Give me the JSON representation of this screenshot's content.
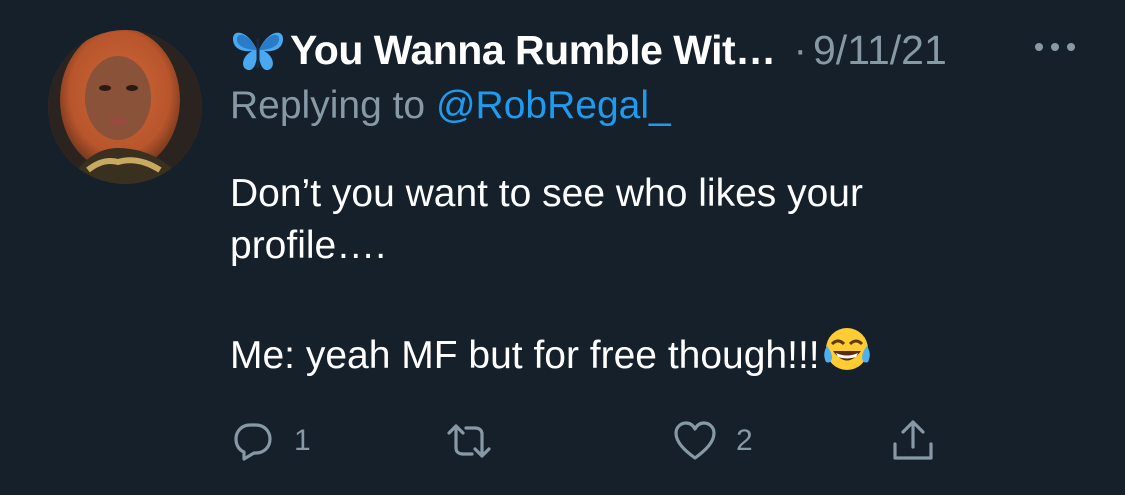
{
  "tweet": {
    "display_name": "You Wanna Rumble Wit…",
    "name_emoji": "butterfly-icon",
    "separator": "·",
    "date": "9/11/21",
    "replying_prefix": "Replying to ",
    "replying_handle": "@RobRegal_",
    "text_line1": "Don’t you want to see who likes your",
    "text_line2": "profile….",
    "text_line3": "Me: yeah MF but for free though!!!",
    "text_emoji": "tears-of-joy-emoji"
  },
  "actions": {
    "reply_count": "1",
    "retweet_count": "",
    "like_count": "2"
  },
  "colors": {
    "background": "#15202b",
    "secondary_text": "#8899a6",
    "link": "#1d9bf0",
    "primary_text": "#ffffff"
  }
}
